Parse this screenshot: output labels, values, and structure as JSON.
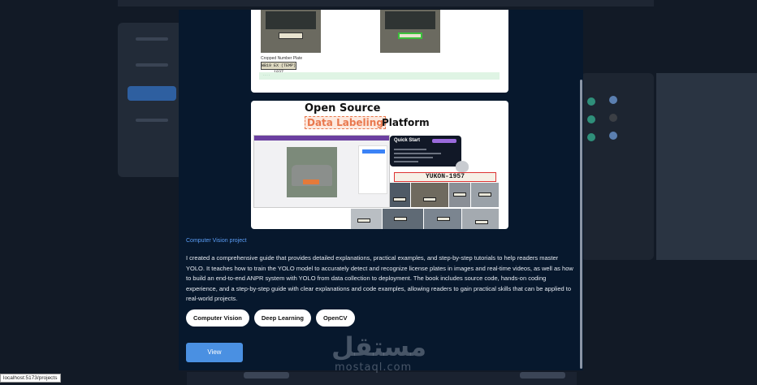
{
  "background": {
    "accent": "#2e5fa0"
  },
  "modal": {
    "screenshot1": {
      "crop_label": "Cropped Number Plate",
      "plate_text": "WB19 EX (TEMP) 1037",
      "result_text": "...."
    },
    "screenshot2": {
      "title_line1": "Open Source",
      "title_highlight": "Data Labeling",
      "title_line2": "Platform",
      "quick_start_title": "Quick Start",
      "plate_banner": "YUKON-1957"
    },
    "project_type": "Computer Vision project",
    "description": "I created a comprehensive guide that provides detailed explanations, practical examples, and step-by-step tutorials to help readers master YOLO. It teaches how to train the YOLO model to accurately detect and recognize license plates in images and real-time videos, as well as how to build an end-to-end ANPR system with YOLO from data collection to deployment. The book includes source code, hands-on coding experience, and a step-by-step guide with clear explanations and code examples, allowing readers to gain practical skills that can be applied to real-world projects.",
    "tags": [
      "Computer Vision",
      "Deep Learning",
      "OpenCV"
    ],
    "view_label": "View",
    "accent_color": "#4a90e2"
  },
  "watermark": {
    "arabic": "مستقل",
    "latin": "mostaql.com"
  },
  "status_bar": {
    "url": "localhost:5173/projects"
  }
}
